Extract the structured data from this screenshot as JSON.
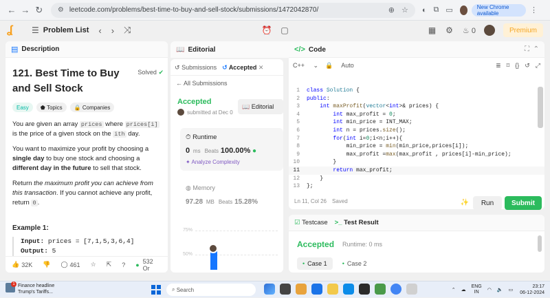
{
  "browser": {
    "url": "leetcode.com/problems/best-time-to-buy-and-sell-stock/submissions/1472042870/",
    "new_chrome_label": "New Chrome available"
  },
  "header": {
    "problem_list_label": "Problem List",
    "premium_label": "Premium",
    "streak_count": "0"
  },
  "description": {
    "tab_label": "Description",
    "title": "121. Best Time to Buy and Sell Stock",
    "solved_label": "Solved",
    "tags": [
      "Easy",
      "Topics",
      "Companies"
    ],
    "para1_a": "You are given an array ",
    "para1_code1": "prices",
    "para1_b": " where ",
    "para1_code2": "prices[i]",
    "para1_c": " is the price of a given stock on the ",
    "para1_code3": "ith",
    "para1_d": " day.",
    "para2_a": "You want to maximize your profit by choosing a ",
    "para2_b1": "single day",
    "para2_c": " to buy one stock and choosing a ",
    "para2_b2": "different day in the future",
    "para2_d": " to sell that stock.",
    "para3_a": "Return ",
    "para3_i": "the maximum profit you can achieve from this transaction",
    "para3_b": ". If you cannot achieve any profit, return ",
    "para3_code": "0",
    "para3_c": ".",
    "example_heading": "Example 1:",
    "example_input_label": "Input:",
    "example_input_value": "prices = [7,1,5,3,6,4]",
    "example_output_label": "Output:",
    "example_output_value": "5",
    "likes": "32K",
    "comments": "461",
    "online": "532 Or"
  },
  "editorial": {
    "tab_label": "Editorial",
    "sub_tab_submissions": "Submissions",
    "sub_tab_accepted": "Accepted",
    "all_submissions": "All Submissions",
    "status": "Accepted",
    "submitted_at": "submitted at Dec 0",
    "editorial_button": "Editorial",
    "runtime_label": "Runtime",
    "runtime_value": "0",
    "runtime_unit": "ms",
    "runtime_beats_label": "Beats",
    "runtime_beats_value": "100.00%",
    "analyze_label": "Analyze Complexity",
    "memory_label": "Memory",
    "memory_value": "97.28",
    "memory_unit": "MB",
    "memory_beats_label": "Beats",
    "memory_beats_value": "15.28%",
    "chart_tick_75": "75%",
    "chart_tick_50": "50%",
    "runtime_bar_fraction": 0.5
  },
  "code": {
    "tab_label": "Code",
    "language": "C++",
    "mode": "Auto",
    "lines": [
      {
        "n": "1",
        "t": "class Solution {"
      },
      {
        "n": "2",
        "t": "public:"
      },
      {
        "n": "3",
        "t": "    int maxProfit(vector<int>& prices) {"
      },
      {
        "n": "4",
        "t": "        int max_profit = 0;"
      },
      {
        "n": "5",
        "t": "        int min_price = INT_MAX;"
      },
      {
        "n": "6",
        "t": "        int n = prices.size();"
      },
      {
        "n": "7",
        "t": "        for(int i=0;i<n;i++){"
      },
      {
        "n": "8",
        "t": "            min_price = min(min_price,prices[i]);"
      },
      {
        "n": "9",
        "t": "            max_profit =max(max_profit , prices[i]-min_price);"
      },
      {
        "n": "10",
        "t": "        }"
      },
      {
        "n": "11",
        "t": "        return max_profit;"
      },
      {
        "n": "12",
        "t": "    }"
      },
      {
        "n": "13",
        "t": "};"
      }
    ],
    "cursor_position": "Ln 11, Col 26",
    "saved_label": "Saved",
    "run_label": "Run",
    "submit_label": "Submit"
  },
  "testcase": {
    "tab_testcase": "Testcase",
    "tab_result": "Test Result",
    "status": "Accepted",
    "runtime": "Runtime: 0 ms",
    "cases": [
      "Case 1",
      "Case 2"
    ]
  },
  "taskbar": {
    "news_title": "Finance headline",
    "news_sub": "Trump's Tariffs...",
    "news_badge": "1",
    "search_placeholder": "Search",
    "lang_top": "ENG",
    "lang_bottom": "IN",
    "time": "23:17",
    "date": "06-12-2024"
  },
  "colors": {
    "accent_green": "#2cbb5d",
    "brand_orange": "#f89f1b",
    "easy_teal": "#00b8a3",
    "chart_blue": "#1677ff"
  }
}
